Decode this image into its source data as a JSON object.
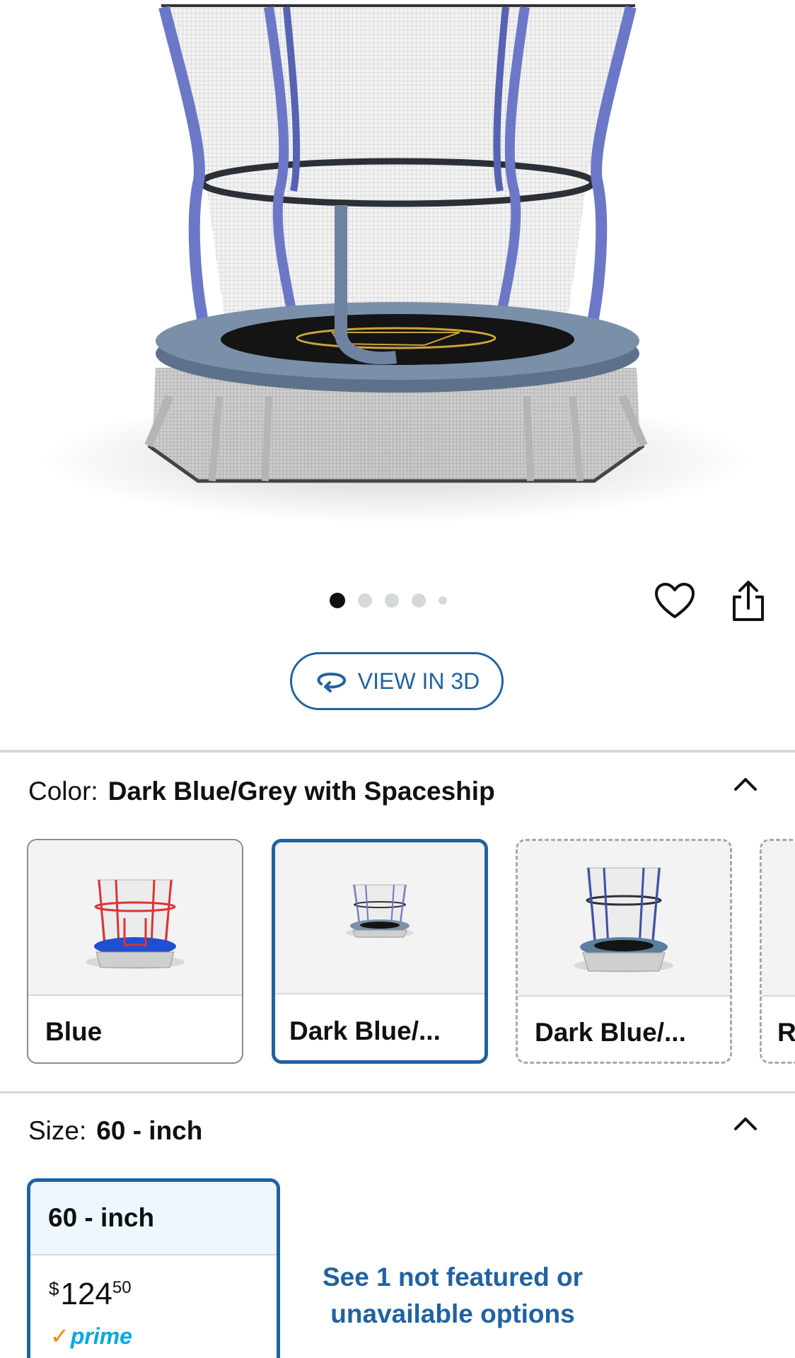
{
  "gallery": {
    "image_count": 5,
    "active_index": 0,
    "view_3d_label": "VIEW IN 3D"
  },
  "color": {
    "label": "Color:",
    "selected": "Dark Blue/Grey with Spaceship",
    "options": [
      {
        "label": "Blue",
        "accent": "#1f4fd1"
      },
      {
        "label": "Dark Blue/...",
        "accent": "#5b7a99"
      },
      {
        "label": "Dark Blue/...",
        "accent": "#3d5f80"
      },
      {
        "label": "R"
      }
    ]
  },
  "size": {
    "label": "Size:",
    "selected": "60 - inch",
    "option": {
      "label": "60 - inch",
      "price_symbol": "$",
      "price_whole": "124",
      "price_fraction": "50",
      "badge": "prime"
    },
    "see_more_text": "See 1 not featured or unavailable options"
  },
  "colors": {
    "link": "#2162a1",
    "selected_border": "#2162a1",
    "prime_blue": "#00a8e1",
    "prime_orange": "#f08804"
  }
}
